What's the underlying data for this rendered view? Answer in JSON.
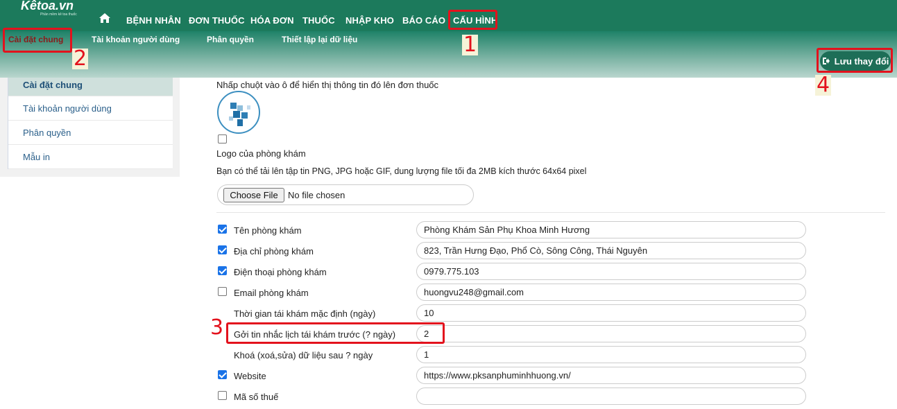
{
  "brand": {
    "name": "Kêtoa.vn",
    "tagline": "Phần mềm kê toa thuốc"
  },
  "nav": {
    "home_icon": "home-icon",
    "items": [
      "BỆNH NHÂN",
      "ĐƠN THUỐC",
      "HÓA ĐƠN",
      "THUỐC",
      "NHẬP KHO",
      "BÁO CÁO",
      "CẤU HÌNH"
    ]
  },
  "subnav": {
    "items": [
      "Cài đặt chung",
      "Tài khoản người dùng",
      "Phân quyền",
      "Thiết lập lại dữ liệu"
    ]
  },
  "save_button": {
    "label": "Lưu thay đổi",
    "icon": "sign-out-icon"
  },
  "sidebar": {
    "items": [
      "Cài đặt chung",
      "Tài khoản người dùng",
      "Phân quyền",
      "Mẫu in"
    ]
  },
  "main": {
    "hint": "Nhấp chuột vào ô để hiển thị thông tin đó lên đơn thuốc",
    "logo_label": "Logo của phòng khám",
    "upload_note": "Bạn có thể tải lên tập tin PNG, JPG hoặc GIF, dung lượng file tối đa 2MB kích thước 64x64 pixel",
    "choose_file": "Choose File",
    "no_file": "No file chosen",
    "fields": [
      {
        "label": "Tên phòng khám",
        "value": "Phòng Khám Sản Phụ Khoa Minh Hương",
        "checked": true
      },
      {
        "label": "Địa chỉ phòng khám",
        "value": "823, Trần Hưng Đạo, Phổ Cò, Sông Công, Thái Nguyên",
        "checked": true
      },
      {
        "label": "Điện thoại phòng khám",
        "value": "0979.775.103",
        "checked": true
      },
      {
        "label": "Email phòng khám",
        "value": "huongvu248@gmail.com",
        "checked": false
      },
      {
        "label": "Thời gian tái khám mặc định (ngày)",
        "value": "10"
      },
      {
        "label": "Gởi tin nhắc lịch tái khám trước (? ngày)",
        "value": "2"
      },
      {
        "label": "Khoá (xoá,sửa) dữ liệu sau ? ngày",
        "value": "1"
      },
      {
        "label": "Website",
        "value": "https://www.pksanphuminhhuong.vn/",
        "checked": true
      },
      {
        "label": "Mã số thuế",
        "value": "",
        "checked": false
      }
    ]
  },
  "annotations": [
    "1",
    "2",
    "3",
    "4"
  ],
  "colors": {
    "header": "#1c7a5c",
    "annotation": "#e3121d",
    "checkbox": "#1a73e8"
  }
}
